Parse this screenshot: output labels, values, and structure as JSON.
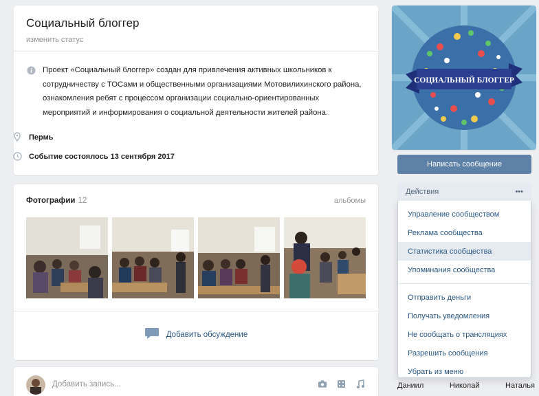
{
  "header": {
    "title": "Социальный блоггер",
    "status_link": "изменить статус"
  },
  "info": {
    "description": "Проект «Социальный блоггер» создан для привлечения активных школьников к сотрудничеству с ТОСами и общественными организациями Мотовилихинского района, ознакомления ребят с процессом организации социально-ориентированных мероприятий и информирования о социальной деятельности жителей района.",
    "city": "Пермь",
    "event": "Событие состоялось 13 сентября 2017"
  },
  "photos": {
    "title": "Фотографии",
    "count": "12",
    "albums_link": "альбомы",
    "discuss_label": "Добавить обсуждение"
  },
  "post": {
    "placeholder": "Добавить запись..."
  },
  "cover": {
    "logo_text": "СОЦИАЛЬНЫЙ БЛОГГЕР"
  },
  "actions": {
    "message_button": "Написать сообщение",
    "header_label": "Действия",
    "more_label": "•••",
    "items": [
      "Управление сообществом",
      "Реклама сообщества",
      "Статистика сообщества",
      "Упоминания сообщества",
      "Отправить деньги",
      "Получать уведомления",
      "Не сообщать о трансляциях",
      "Разрешить сообщения",
      "Убрать из меню"
    ]
  },
  "members": [
    "Даниил",
    "Николай",
    "Наталья"
  ],
  "colors": {
    "page_bg": "#edeef0",
    "link": "#2a5885",
    "button": "#5e81a8",
    "cover_bg": "#6aa5c8",
    "banner": "#2a3f8f"
  }
}
